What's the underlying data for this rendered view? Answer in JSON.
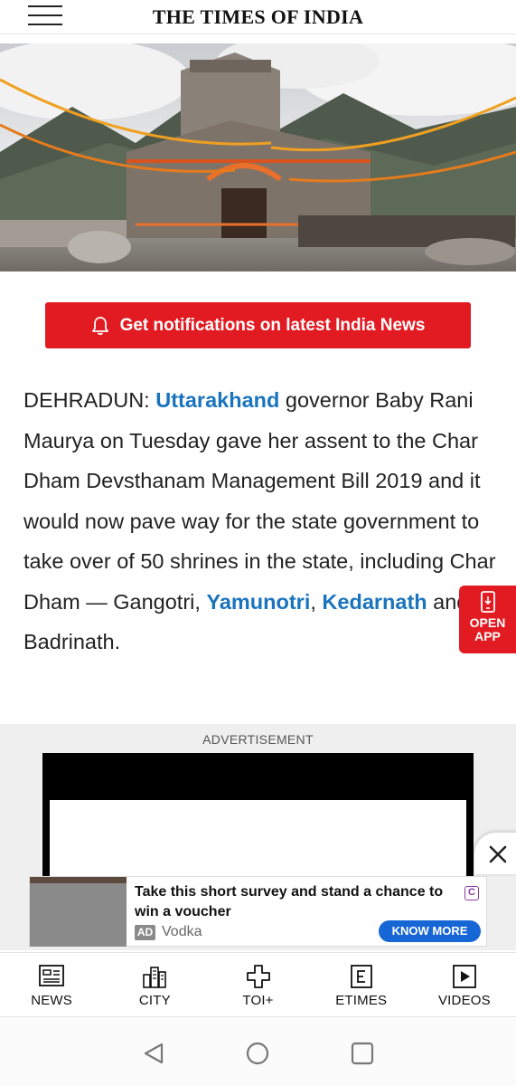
{
  "header": {
    "logo_text": "THE TIMES OF INDIA",
    "menu_icon": "hamburger-menu-icon"
  },
  "hero": {
    "image_description": "kedarnath-temple-photo"
  },
  "notification_button": {
    "label": "Get notifications on latest India News",
    "icon": "bell-icon",
    "color": "#e21b22"
  },
  "article": {
    "dateline": "DEHRADUN: ",
    "link_uttarakhand": "Uttarakhand",
    "text_1": " governor Baby Rani Maurya on Tuesday gave her assent to the Char Dham Devsthanam Management Bill 2019 and it would now pave way for the state government to take over of 50 shrines in the state, including Char Dham — Gangotri, ",
    "link_yamunotri": "Yamunotri",
    "text_2": ", ",
    "link_kedarnath": "Kedarnath",
    "text_3": " and Badrinath.",
    "link_color": "#1a74bd"
  },
  "open_app": {
    "line1": "OPEN",
    "line2": "APP",
    "icon": "phone-icon"
  },
  "advertisement": {
    "label": "ADVERTISEMENT"
  },
  "close_ad": {
    "icon": "close-icon"
  },
  "banner_ad": {
    "headline": "Take this short survey and stand a chance to win a voucher",
    "badge": "AD",
    "sponsor": "Vodka",
    "cta": "KNOW MORE",
    "choices_glyph": "C",
    "cta_color": "#1766d6"
  },
  "bottom_nav": {
    "items": [
      {
        "label": "NEWS",
        "icon": "newspaper-icon"
      },
      {
        "label": "CITY",
        "icon": "city-buildings-icon"
      },
      {
        "label": "TOI+",
        "icon": "plus-icon"
      },
      {
        "label": "ETIMES",
        "icon": "etimes-icon"
      },
      {
        "label": "VIDEOS",
        "icon": "play-icon"
      }
    ]
  },
  "system_nav": {
    "back": "back-triangle-icon",
    "home": "home-circle-icon",
    "recents": "recents-square-icon"
  }
}
